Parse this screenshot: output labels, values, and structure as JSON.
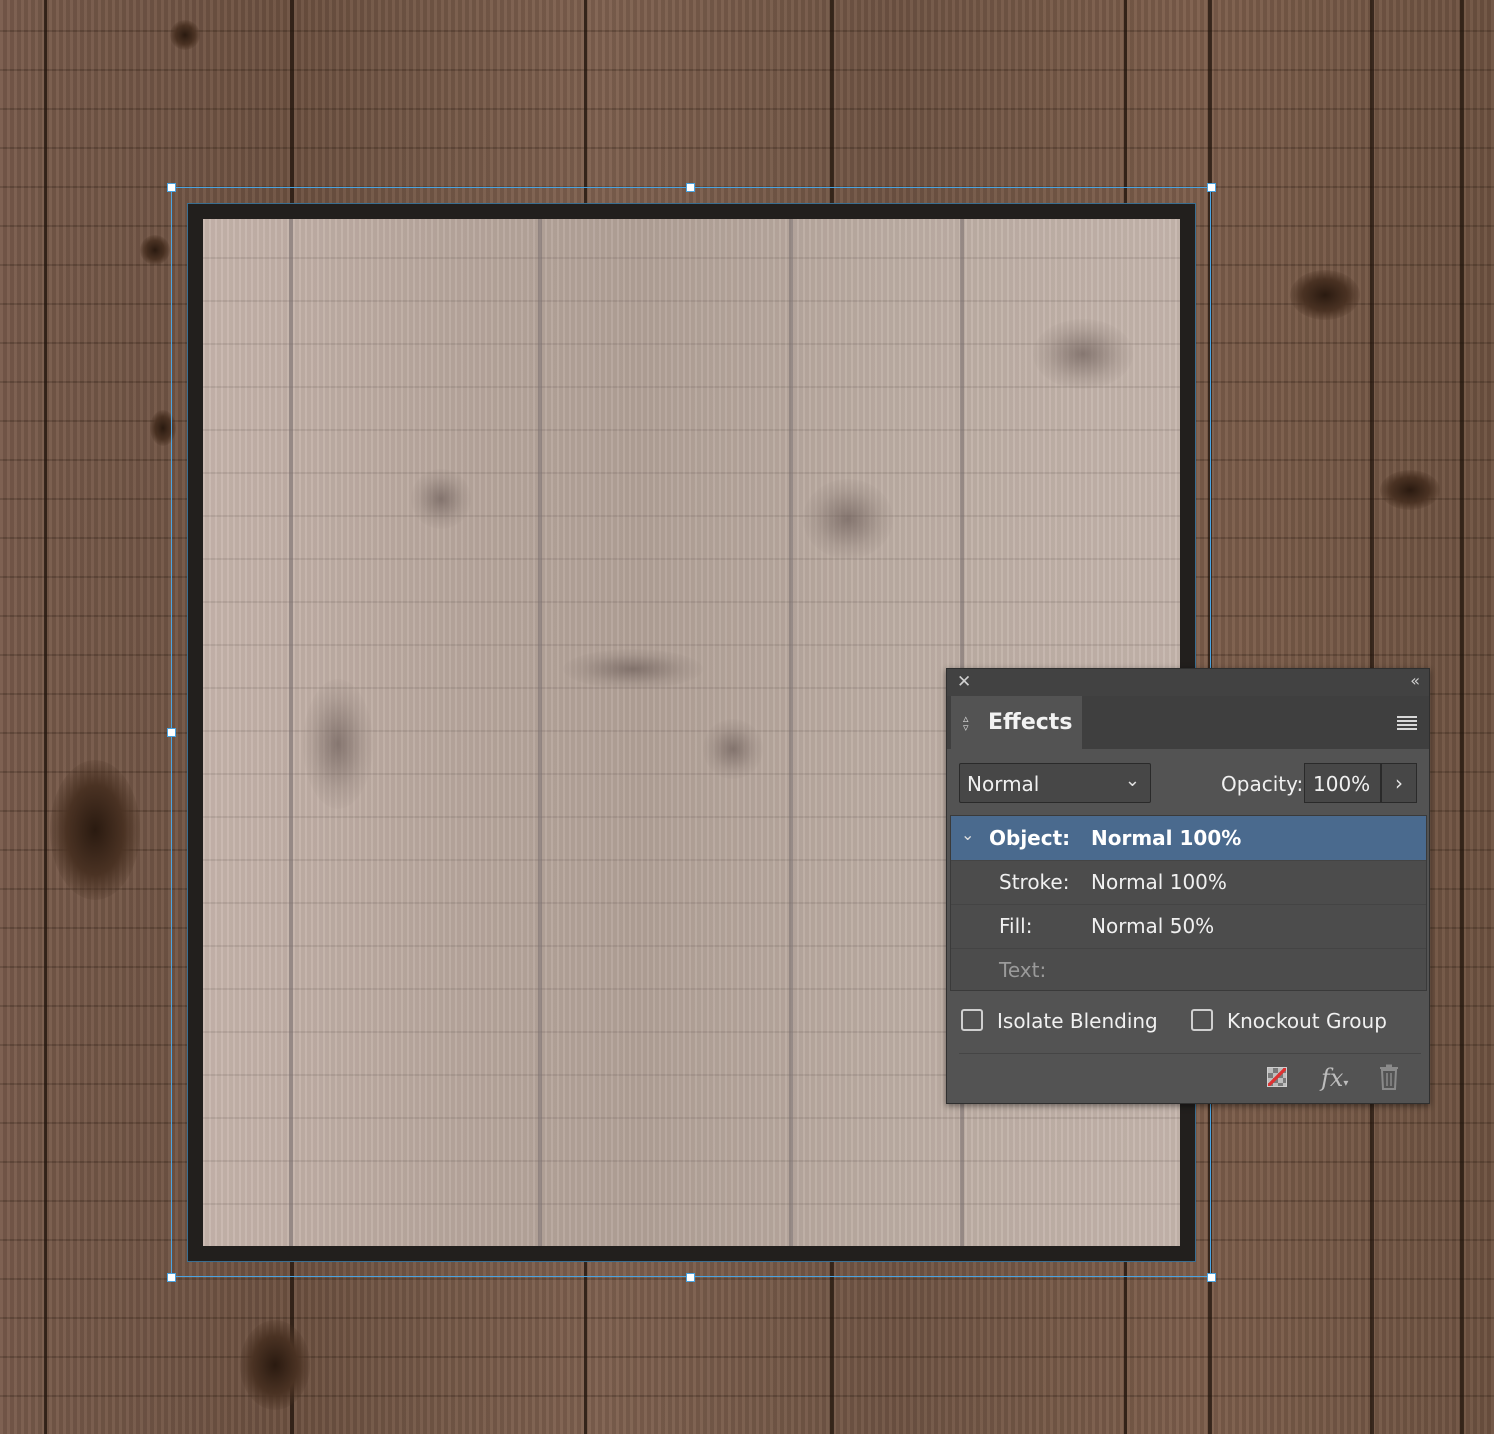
{
  "panel": {
    "title": "Effects",
    "blend_mode": "Normal",
    "opacity_label": "Opacity:",
    "opacity_value": "100%",
    "rows": [
      {
        "label": "Object:",
        "value": "Normal 100%",
        "selected": true
      },
      {
        "label": "Stroke:",
        "value": "Normal 100%"
      },
      {
        "label": "Fill:",
        "value": "Normal 50%"
      },
      {
        "label": "Text:",
        "value": ""
      }
    ],
    "isolate_blending": {
      "label": "Isolate Blending",
      "checked": false
    },
    "knockout_group": {
      "label": "Knockout Group",
      "checked": false
    }
  },
  "icons": [
    "close-icon",
    "collapse-icon",
    "panel-menu-icon",
    "dropdown-chevron-icon",
    "arrow-right-icon",
    "disclosure-triangle-icon",
    "clear-effects-icon",
    "fx-icon",
    "trash-icon"
  ],
  "colors": {
    "selection": "#4aa3e0",
    "panel_bg": "#535353",
    "row_selected": "#4a6a8e",
    "frame_stroke": "#221f1d"
  }
}
